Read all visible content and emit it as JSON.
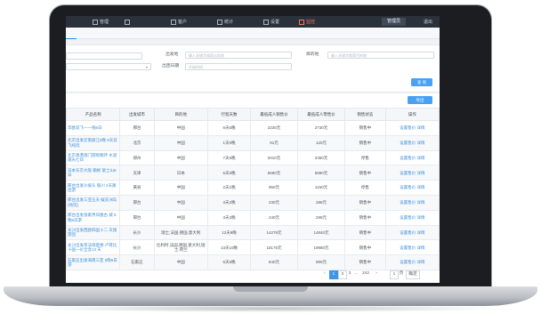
{
  "nav": {
    "items": [
      "管理",
      "",
      "客户",
      "统计",
      "设置",
      "监控"
    ],
    "user": "管理员",
    "logout": "退出"
  },
  "filter": {
    "label_origin": "出发地",
    "placeholder_origin": "输入关键字搜索出发地",
    "label_dest": "目的地",
    "placeholder_dest": "输入关键字搜索目的地",
    "label_date": "出团日期",
    "placeholder_date": "开始时间",
    "search_button": "查 询",
    "export_button": "导出"
  },
  "table": {
    "headers": [
      "产品名称",
      "出发城市",
      "目的地",
      "行程天数",
      "最低成人销售价",
      "最低成人零售价",
      "销售状态",
      "操作"
    ],
    "rows": [
      {
        "name": "华欧双飞一一线6日",
        "city": "邢台",
        "dest": "中国",
        "days": "6天5晚",
        "sale": "2230元",
        "retail": "2730元",
        "status": "销售中",
        "ops": "设置售价  详情"
      },
      {
        "name": "北京出发云南丽江8晚 9天双飞纯玩",
        "city": "北京",
        "dest": "中国",
        "days": "1天0晚",
        "sale": "91元",
        "retail": "120元",
        "status": "销售中",
        "ops": "设置售价  详情"
      },
      {
        "name": "北京香港澳门游购物环 水道观光七日",
        "city": "郑州",
        "dest": "中国",
        "days": "7天6晚",
        "sale": "2010元",
        "retail": "2350元",
        "status": "停售",
        "ops": "设置售价  详情"
      },
      {
        "name": "日本东京大阪 箱根 富士山8日",
        "city": "天津",
        "dest": "日本",
        "days": "6天5晚",
        "sale": "5590元",
        "retail": "5890元",
        "status": "销售中",
        "ops": "设置售价  详情"
      },
      {
        "name": "邢台出发沙坡头 银川 2天跟团游",
        "city": "黄县",
        "dest": "中国",
        "days": "2天1晚",
        "sale": "950元",
        "retail": "1150元",
        "status": "停售",
        "ops": "设置售价  详情"
      },
      {
        "name": "邢台出发三亚五天 蜈支洲岛 (纯玩)",
        "city": "邢台",
        "dest": "中国",
        "days": "3天2晚",
        "sale": "230元",
        "retail": "288元",
        "status": "销售中",
        "ops": "设置售价  详情"
      },
      {
        "name": "邢台出发张家界凤凰古 城 5晚6日游",
        "city": "邢台",
        "dest": "中国",
        "days": "3天2晚",
        "sale": "240元",
        "retail": "298元",
        "status": "销售中",
        "ops": "设置售价  详情"
      },
      {
        "name": "长沙出发西欧四国十二 天旅游团",
        "city": "长沙",
        "dest": "瑞士,法国,德国,意大利",
        "days": "12天9晚",
        "sale": "14279元",
        "retail": "14840元",
        "status": "销售中",
        "ops": "设置售价  详情"
      },
      {
        "name": "长沙出发英法瑞意德 卢荷比十国一价全含13 天",
        "city": "长沙",
        "dest": "比利时,法国,德国,意大利,瑞士,荷兰",
        "days": "13天10晚",
        "sale": "18175元",
        "retail": "19980元",
        "status": "销售中",
        "ops": "设置售价  详情"
      },
      {
        "name": "石家庄出发海南三亚 5晚6日游",
        "city": "石家庄",
        "dest": "中国",
        "days": "6天5晚",
        "sale": "840元",
        "retail": "990元",
        "status": "销售中",
        "ops": "设置售价  详情"
      }
    ]
  },
  "pager": {
    "prev": "‹",
    "pages": [
      "1",
      "2",
      "3"
    ],
    "ellipsis": "…",
    "last": "242",
    "next": "›",
    "goto_value": "1",
    "goto_label": "页",
    "confirm": "确定"
  }
}
